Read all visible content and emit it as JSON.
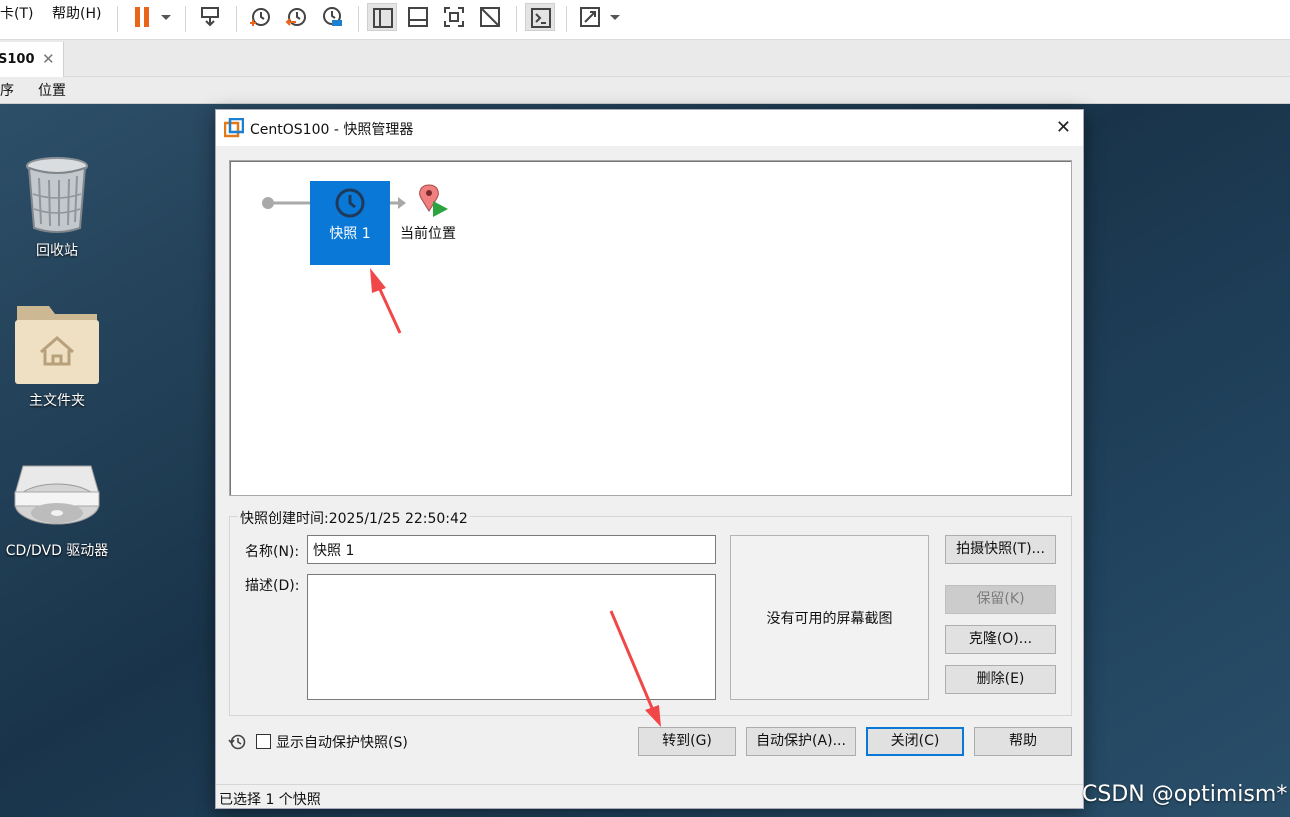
{
  "host_menu": {
    "tab_item": "卡(T)",
    "help_item": "帮助(H)"
  },
  "host_toolbar": {
    "icons": [
      "pause-icon",
      "dropdown-icon",
      "send-ctrl-alt-del-icon",
      "take-snapshot-icon",
      "revert-snapshot-icon",
      "snapshot-manager-icon",
      "library-view-icon",
      "thumbnail-bar-icon",
      "full-screen-icon",
      "unity-icon",
      "console-view-icon",
      "stretch-icon",
      "dropdown-icon"
    ]
  },
  "tab": {
    "label": "S100",
    "close_icon": "close-icon"
  },
  "guest_menu": {
    "app_item": "序",
    "places_item": "位置"
  },
  "desktop": {
    "icons": [
      {
        "label": "回收站",
        "icon": "trash-icon"
      },
      {
        "label": "主文件夹",
        "icon": "home-folder-icon"
      },
      {
        "label": "CD/DVD 驱动器",
        "icon": "optical-drive-icon"
      }
    ]
  },
  "dialog": {
    "title": "CentOS100 - 快照管理器",
    "tree": {
      "snapshot_name": "快照 1",
      "current_location": "当前位置"
    },
    "created_time": "快照创建时间:2025/1/25 22:50:42",
    "name_label": "名称(N):",
    "name_value": "快照 1",
    "description_label": "描述(D):",
    "description_value": "",
    "screenshot_text": "没有可用的屏幕截图",
    "buttons": {
      "take_snapshot": "拍摄快照(T)...",
      "keep": "保留(K)",
      "clone": "克隆(O)...",
      "delete": "删除(E)",
      "goto": "转到(G)",
      "autoprotect": "自动保护(A)...",
      "close": "关闭(C)",
      "help": "帮助"
    },
    "show_autoprotect_label": "显示自动保护快照(S)",
    "show_autoprotect_checked": false,
    "status": "已选择 1 个快照"
  },
  "watermark": "CSDN @optimism*",
  "colors": {
    "accent": "#0a78d6",
    "annotation_arrow": "#f04848",
    "pause_orange": "#e8651a"
  }
}
